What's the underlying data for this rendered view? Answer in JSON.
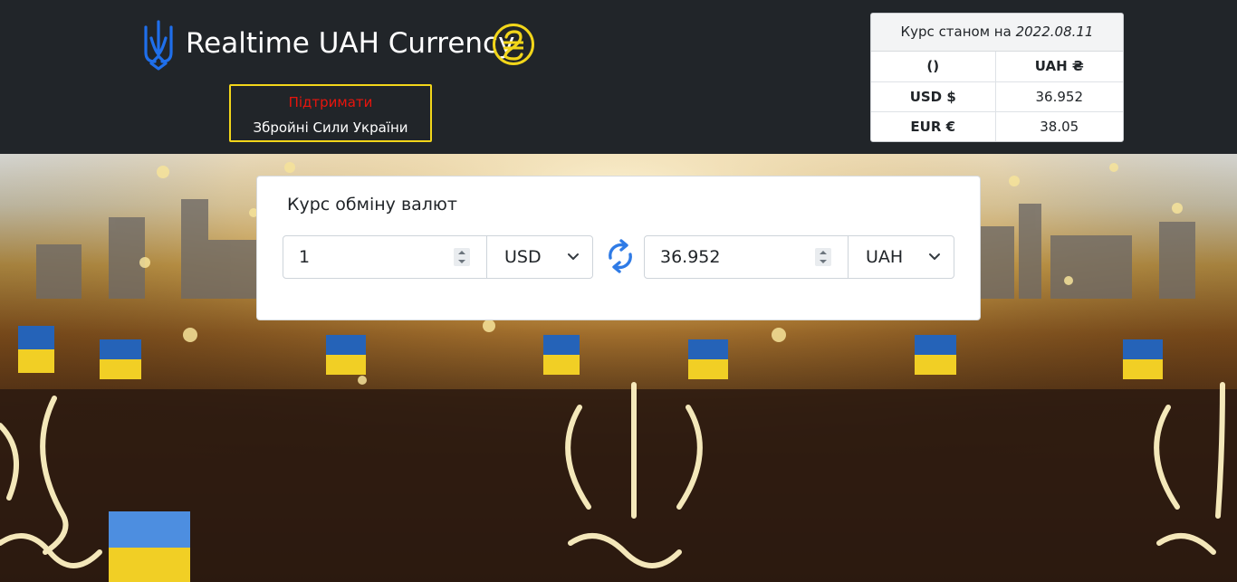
{
  "header": {
    "brand": "Realtime UAH Currency",
    "support_line1": "Підтримати",
    "support_line2": "Збройні Сили України"
  },
  "rates": {
    "caption_prefix": "Курс станом на",
    "date": "2022.08.11",
    "header_left": "()",
    "header_right": "UAH ₴",
    "rows": [
      {
        "currency": "USD $",
        "value": "36.952"
      },
      {
        "currency": "EUR €",
        "value": "38.05"
      }
    ]
  },
  "converter": {
    "title": "Курс обміну валют",
    "from_amount": "1",
    "from_currency": "USD",
    "to_amount": "36.952",
    "to_currency": "UAH"
  },
  "colors": {
    "header_bg": "#212529",
    "accent_yellow": "#f2d61a",
    "support_red": "#e8150d",
    "logo_blue": "#1f6feb",
    "swap_blue": "#2f7be6"
  },
  "icons": {
    "logo": "trident-icon",
    "currency": "hryvnia-icon",
    "swap": "swap-arrows-icon",
    "dropdown": "chevron-down-icon",
    "spinner": "number-spinner-icon"
  }
}
